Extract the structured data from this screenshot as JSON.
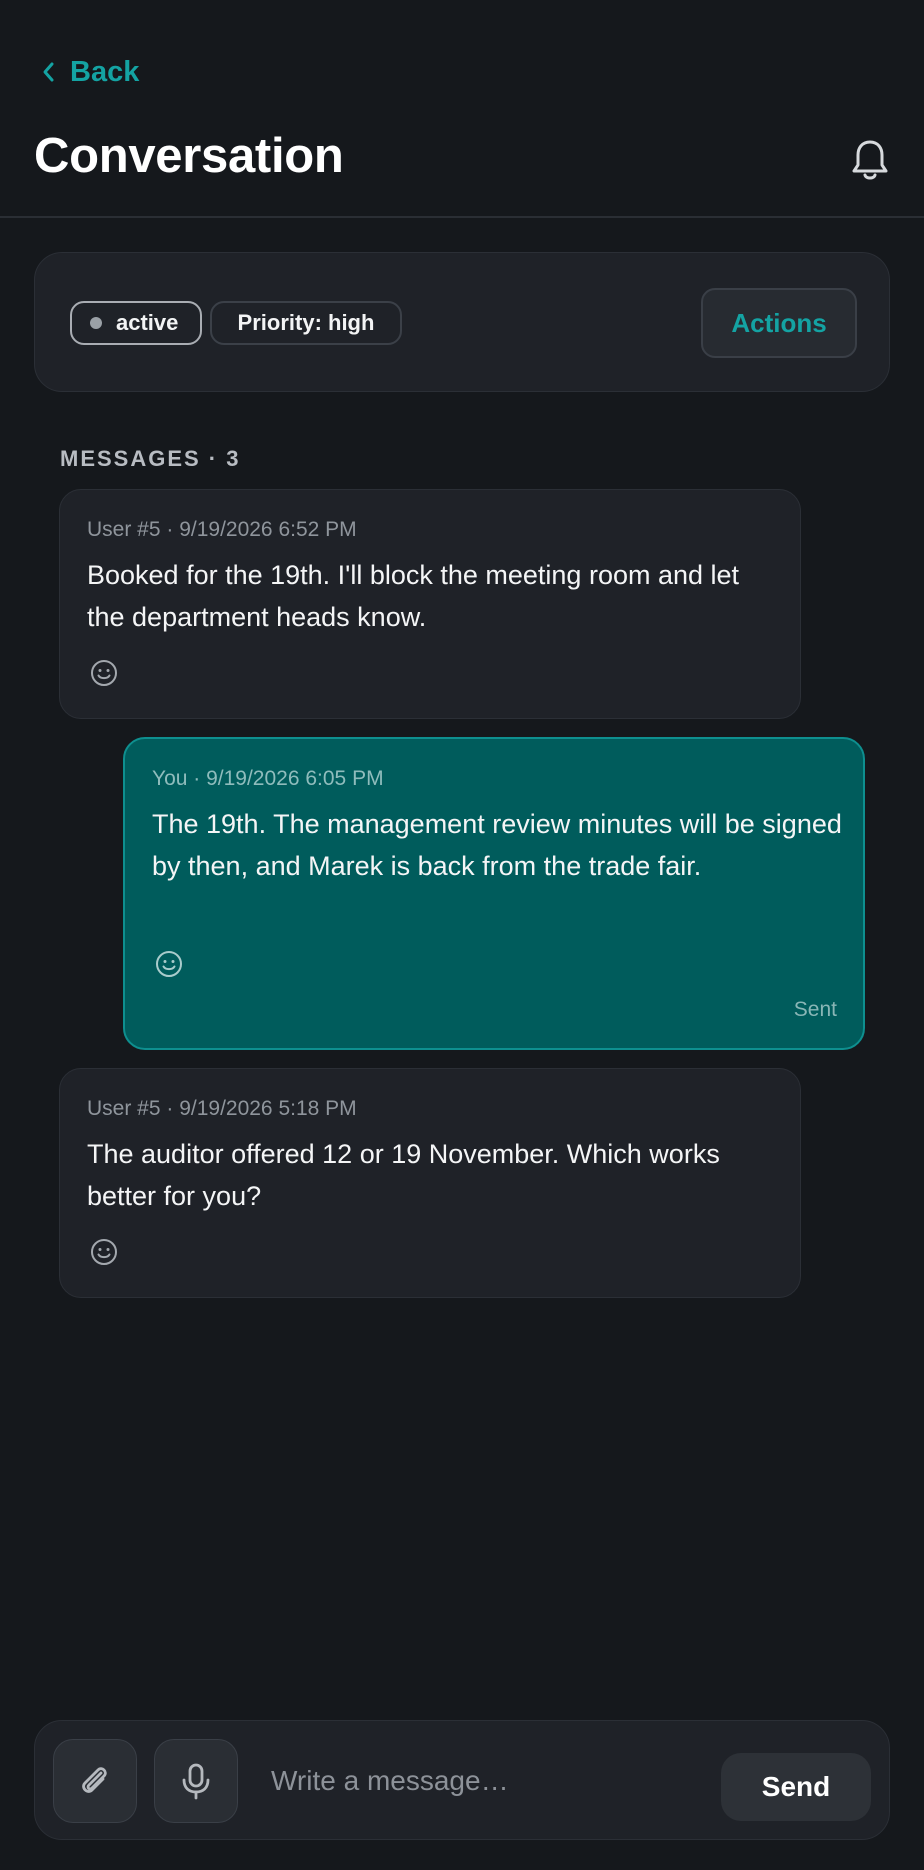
{
  "header": {
    "back_label": "Back",
    "title": "Conversation",
    "notification_icon": "bell-icon"
  },
  "status": {
    "state_label": "active",
    "priority_label": "Priority: high",
    "actions_label": "Actions"
  },
  "messages_section": {
    "label": "MESSAGES · 3"
  },
  "messages": [
    {
      "direction": "incoming",
      "meta": "User #5 · 9/19/2026 6:52 PM",
      "text": "Booked for the 19th. I'll block the meeting room and let the department heads know.",
      "reaction_icon": "smile-icon"
    },
    {
      "direction": "outgoing",
      "meta": "You · 9/19/2026 6:05 PM",
      "text": "The 19th. The management review minutes will be signed by then, and Marek is back from the trade fair.",
      "reaction_icon": "smile-icon",
      "status": "Sent"
    },
    {
      "direction": "incoming",
      "meta": "User #5 · 9/19/2026 5:18 PM",
      "text": "The auditor offered 12 or 19 November. Which works better for you?",
      "reaction_icon": "smile-icon"
    }
  ],
  "composer": {
    "attach_icon": "paperclip-icon",
    "mic_icon": "microphone-icon",
    "placeholder": "Write a message…",
    "value": "",
    "send_label": "Send"
  },
  "colors": {
    "background": "#15181c",
    "card": "#1f2228",
    "accent": "#14a3a3",
    "outgoing_bubble": "#005c5c"
  }
}
